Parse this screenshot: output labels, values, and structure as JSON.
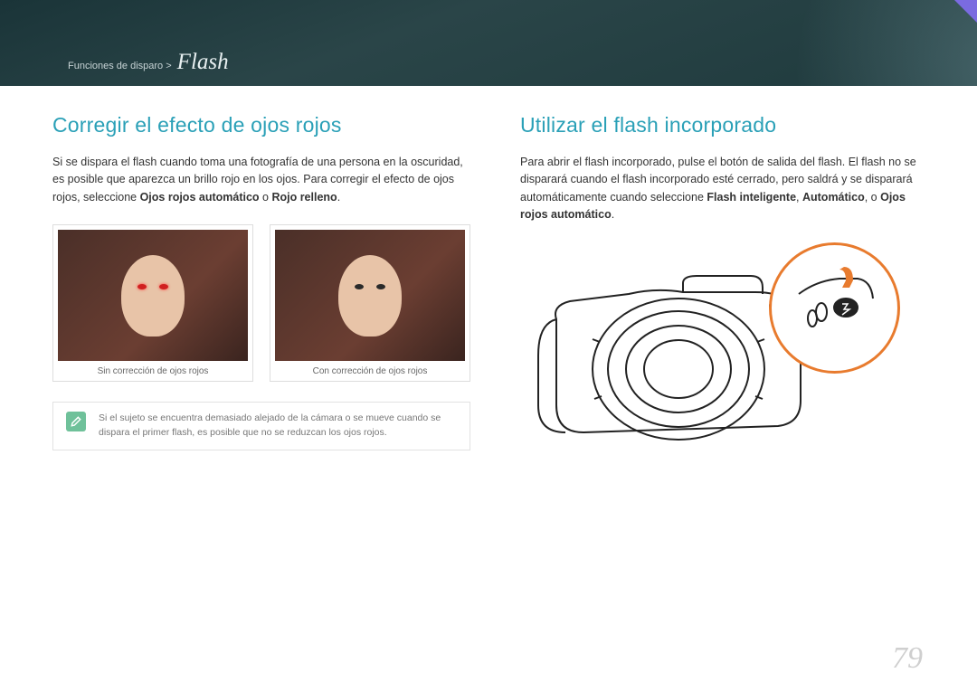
{
  "header": {
    "breadcrumb_prefix": "Funciones de disparo >",
    "breadcrumb_main": "Flash"
  },
  "left": {
    "heading": "Corregir el efecto de ojos rojos",
    "para_1": "Si se dispara el flash cuando toma una fotografía de una persona en la oscuridad, es posible que aparezca un brillo rojo en los ojos. Para corregir el efecto de ojos rojos, seleccione ",
    "bold_1": "Ojos rojos automático",
    "para_2": " o ",
    "bold_2": "Rojo relleno",
    "para_3": ".",
    "caption_a": "Sin corrección de ojos rojos",
    "caption_b": "Con corrección de ojos rojos",
    "note": "Si el sujeto se encuentra demasiado alejado de la cámara o se mueve cuando se dispara el primer flash, es posible que no se reduzcan los ojos rojos."
  },
  "right": {
    "heading": "Utilizar el flash incorporado",
    "para_1": "Para abrir el flash incorporado, pulse el botón de salida del flash. El flash no se disparará cuando el flash incorporado esté cerrado, pero saldrá y se disparará automáticamente cuando seleccione ",
    "bold_1": "Flash inteligente",
    "para_2": ", ",
    "bold_2": "Automático",
    "para_3": ", o ",
    "bold_3": "Ojos rojos automático",
    "para_4": "."
  },
  "page_number": "79"
}
